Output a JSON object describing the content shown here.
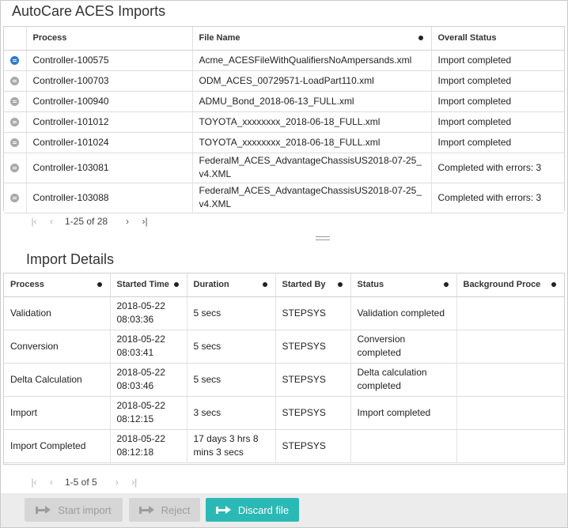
{
  "app": {
    "title": "AutoCare ACES Imports"
  },
  "imports": {
    "columns": {
      "process": "Process",
      "file_name": "File Name",
      "status": "Overall Status"
    },
    "rows": [
      {
        "process": "Controller-100575",
        "file": "Acme_ACESFileWithQualifiersNoAmpersands.xml",
        "status": "Import completed",
        "active": true
      },
      {
        "process": "Controller-100703",
        "file": "ODM_ACES_00729571-LoadPart110.xml",
        "status": "Import completed",
        "active": false
      },
      {
        "process": "Controller-100940",
        "file": "ADMU_Bond_2018-06-13_FULL.xml",
        "status": "Import completed",
        "active": false
      },
      {
        "process": "Controller-101012",
        "file": "TOYOTA_xxxxxxxx_2018-06-18_FULL.xml",
        "status": "Import completed",
        "active": false
      },
      {
        "process": "Controller-101024",
        "file": "TOYOTA_xxxxxxxx_2018-06-18_FULL.xml",
        "status": "Import completed",
        "active": false
      },
      {
        "process": "Controller-103081",
        "file": "FederalM_ACES_AdvantageChassisUS2018-07-25_v4.XML",
        "status": "Completed with errors: 3",
        "active": false
      },
      {
        "process": "Controller-103088",
        "file": "FederalM_ACES_AdvantageChassisUS2018-07-25_v4.XML",
        "status": "Completed with errors: 3",
        "active": false
      }
    ],
    "pager": {
      "text": "1-25 of 28"
    }
  },
  "details": {
    "title": "Import Details",
    "columns": {
      "process": "Process",
      "started_time": "Started Time",
      "duration": "Duration",
      "started_by": "Started By",
      "status": "Status",
      "background": "Background Proce"
    },
    "rows": [
      {
        "process": "Validation",
        "started": "2018-05-22 08:03:36",
        "duration": "5 secs",
        "by": "STEPSYS",
        "status": "Validation completed",
        "bg": ""
      },
      {
        "process": "Conversion",
        "started": "2018-05-22 08:03:41",
        "duration": "5 secs",
        "by": "STEPSYS",
        "status": "Conversion completed",
        "bg": ""
      },
      {
        "process": "Delta Calculation",
        "started": "2018-05-22 08:03:46",
        "duration": "5 secs",
        "by": "STEPSYS",
        "status": "Delta calculation completed",
        "bg": ""
      },
      {
        "process": "Import",
        "started": "2018-05-22 08:12:15",
        "duration": "3 secs",
        "by": "STEPSYS",
        "status": "Import completed",
        "bg": ""
      },
      {
        "process": "Import Completed",
        "started": "2018-05-22 08:12:18",
        "duration": "17 days 3 hrs 8 mins 3 secs",
        "by": "STEPSYS",
        "status": "",
        "bg": ""
      }
    ],
    "pager": {
      "text": "1-5 of 5"
    }
  },
  "footer": {
    "start_import": "Start import",
    "reject": "Reject",
    "discard": "Discard file"
  },
  "colors": {
    "accent": "#2bb9b5",
    "active_icon": "#2e7bcf",
    "disabled": "#d6d6d6"
  }
}
